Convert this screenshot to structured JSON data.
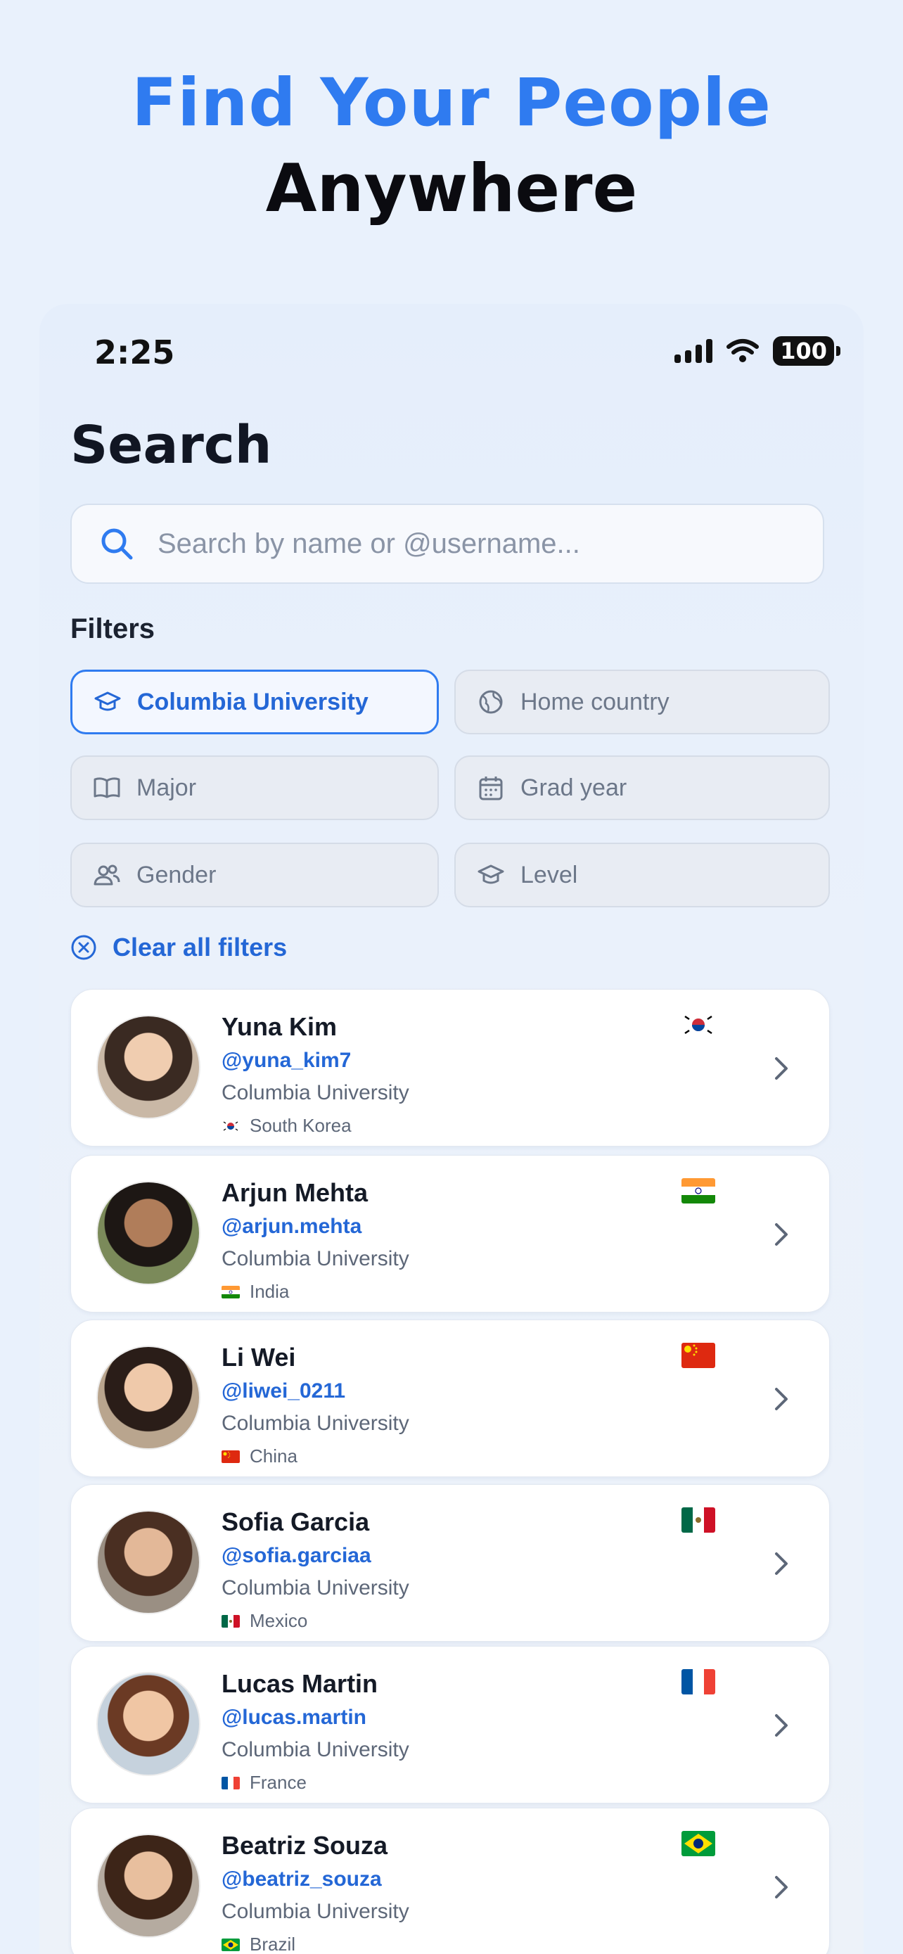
{
  "headline": {
    "line1": "Find Your People",
    "line2": "Anywhere"
  },
  "status_bar": {
    "time": "2:25",
    "battery": "100"
  },
  "page": {
    "title": "Search"
  },
  "search": {
    "placeholder": "Search by name or @username..."
  },
  "filters": {
    "label": "Filters",
    "chips": [
      {
        "label": "Columbia University",
        "icon": "graduation-cap-icon",
        "active": true
      },
      {
        "label": "Home country",
        "icon": "globe-icon",
        "active": false
      },
      {
        "label": "Major",
        "icon": "book-icon",
        "active": false
      },
      {
        "label": "Grad year",
        "icon": "calendar-icon",
        "active": false
      },
      {
        "label": "Gender",
        "icon": "users-icon",
        "active": false
      },
      {
        "label": "Level",
        "icon": "graduation-cap-icon",
        "active": false
      }
    ],
    "clear_label": "Clear all filters"
  },
  "results": [
    {
      "name": "Yuna Kim",
      "username": "@yuna_kim7",
      "school": "Columbia University",
      "country": "South Korea",
      "flag": "south-korea-flag"
    },
    {
      "name": "Arjun Mehta",
      "username": "@arjun.mehta",
      "school": "Columbia University",
      "country": "India",
      "flag": "india-flag"
    },
    {
      "name": "Li Wei",
      "username": "@liwei_0211",
      "school": "Columbia University",
      "country": "China",
      "flag": "china-flag"
    },
    {
      "name": "Sofia Garcia",
      "username": "@sofia.garciaa",
      "school": "Columbia University",
      "country": "Mexico",
      "flag": "mexico-flag"
    },
    {
      "name": "Lucas Martin",
      "username": "@lucas.martin",
      "school": "Columbia University",
      "country": "France",
      "flag": "france-flag"
    },
    {
      "name": "Beatriz Souza",
      "username": "@beatriz_souza",
      "school": "Columbia University",
      "country": "Brazil",
      "flag": "brazil-flag"
    }
  ],
  "colors": {
    "accent": "#2f7bf0",
    "link": "#2467d6",
    "background": "#e9f1fc"
  }
}
